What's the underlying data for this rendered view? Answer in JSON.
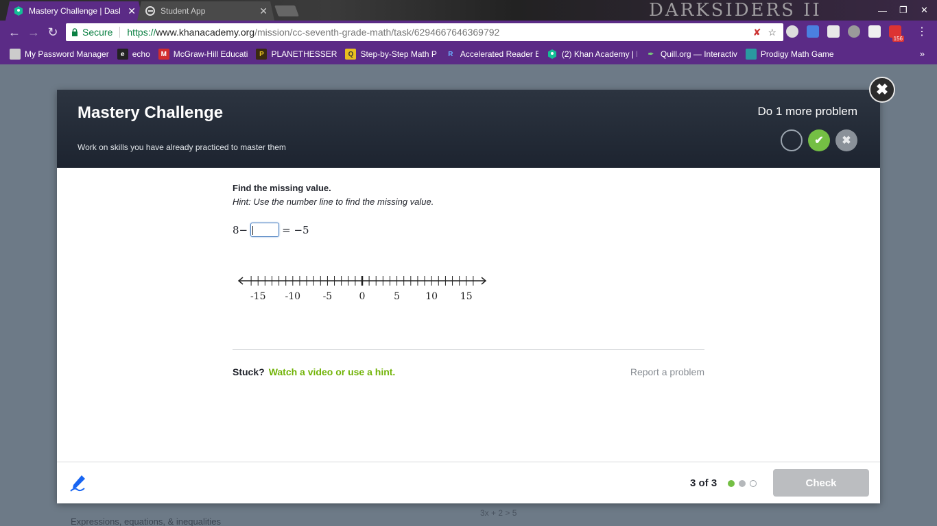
{
  "browser": {
    "tabs": [
      {
        "title": "Mastery Challenge | Dasl",
        "active": true
      },
      {
        "title": "Student App",
        "active": false
      }
    ],
    "brand_art_text": "DARKSIDERS II",
    "omnibox": {
      "secure_label": "Secure",
      "url_scheme": "https://",
      "url_host": "www.khanacademy.org",
      "url_path": "/mission/cc-seventh-grade-math/task/6294667646369792"
    },
    "extension_badge": "156",
    "bookmarks": [
      {
        "label": "My Password Manager",
        "icon_color": "#555555"
      },
      {
        "label": "echo",
        "icon_color": "#222222"
      },
      {
        "label": "McGraw-Hill Educati",
        "icon_color": "#d22d2d"
      },
      {
        "label": "PLANETHESSER",
        "icon_color": "#3a2a10"
      },
      {
        "label": "Step-by-Step Math P",
        "icon_color": "#e8c020"
      },
      {
        "label": "Accelerated Reader E",
        "icon_color": "#1a6fb0"
      },
      {
        "label": "(2) Khan Academy | I",
        "icon_color": "#14bf96"
      },
      {
        "label": "Quill.org — Interactiv",
        "icon_color": "#2a8a3a"
      },
      {
        "label": "Prodigy Math Game",
        "icon_color": "#2a9aa0"
      }
    ],
    "bookmarks_more": "»"
  },
  "modal": {
    "title": "Mastery Challenge",
    "subtitle": "Work on skills you have already practiced to master them",
    "remaining": "Do 1 more problem",
    "question_title": "Find the missing value.",
    "hint": "Hint: Use the number line to find the missing value.",
    "equation": {
      "left": "8−",
      "right": "= −5",
      "answer_value": ""
    },
    "number_line": {
      "min": -17,
      "max": 17,
      "labels": [
        "-15",
        "-10",
        "-5",
        "0",
        "5",
        "10",
        "15"
      ],
      "label_values": [
        -15,
        -10,
        -5,
        0,
        5,
        10,
        15
      ]
    },
    "stuck_label": "Stuck?",
    "stuck_link": "Watch a video or use a hint.",
    "report": "Report a problem",
    "counter": "3 of 3",
    "check_label": "Check"
  },
  "colors": {
    "accent_green": "#74bf44",
    "browser_purple": "#5b2b86",
    "header_dark": "#1d2430"
  },
  "background": {
    "text1": "Expressions, equations, & inequalities",
    "text2": "3x + 2 > 5"
  }
}
